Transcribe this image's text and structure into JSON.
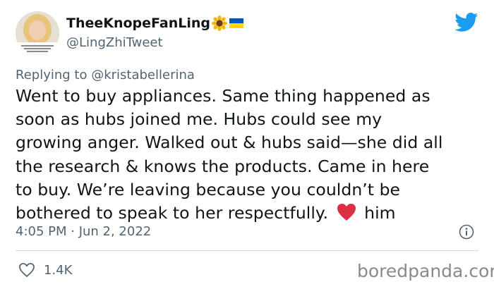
{
  "author": {
    "display_name": "TheeKnopeFanLing",
    "handle": "@LingZhiTweet",
    "emojis": [
      "sunflower-emoji",
      "ukraine-flag-emoji"
    ]
  },
  "reply": {
    "prefix": "Replying to",
    "mention": "@kristabellerina"
  },
  "tweet": {
    "lines": [
      "Went to buy appliances. Same thing happened as",
      "soon as hubs joined me. Hubs could see my",
      "growing anger. Walked out & hubs said—she did all",
      "the research & knows the products. Came in here",
      "to buy. We’re leaving because you couldn’t be"
    ],
    "last_line_start": "bothered to speak to her respectfully.",
    "last_line_end": "him",
    "emoji": "red-heart-emoji"
  },
  "meta": {
    "timestamp": "4:05 PM · Jun 2, 2022"
  },
  "actions": {
    "likes": "1.4K"
  },
  "watermark": "boredpanda.com",
  "colors": {
    "twitter_blue": "#1d9bf0",
    "secondary_text": "#536471",
    "heart_red": "#e0245e"
  }
}
